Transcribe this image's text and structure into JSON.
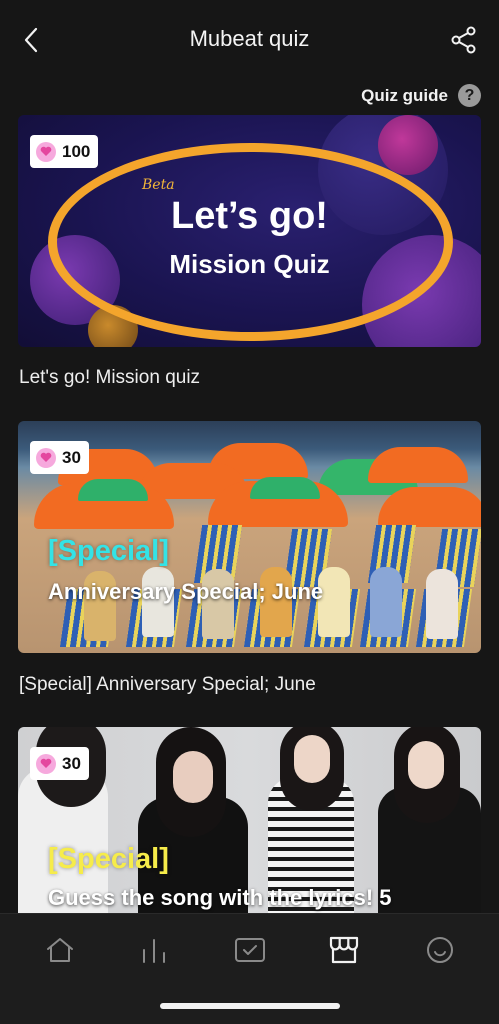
{
  "header": {
    "title": "Mubeat quiz",
    "back_icon": "chevron-left-icon",
    "share_icon": "share-icon"
  },
  "guide": {
    "label": "Quiz guide",
    "help_glyph": "?"
  },
  "cards": [
    {
      "badge_value": "100",
      "banner_beta": "Beta",
      "banner_line1": "Let’s go!",
      "banner_line2": "Mission Quiz",
      "caption": "Let's go! Mission quiz"
    },
    {
      "badge_value": "30",
      "banner_tag": "[Special]",
      "banner_title": "Anniversary Special; June",
      "caption": "[Special] Anniversary Special; June"
    },
    {
      "badge_value": "30",
      "banner_tag": "[Special]",
      "banner_title": "Guess the song with the lyrics! 5"
    }
  ],
  "tabs": [
    {
      "icon": "home-icon",
      "active": false
    },
    {
      "icon": "chart-icon",
      "active": false
    },
    {
      "icon": "quiz-check-icon",
      "active": false
    },
    {
      "icon": "store-icon",
      "active": true
    },
    {
      "icon": "smile-icon",
      "active": false
    }
  ],
  "colors": {
    "background": "#161616",
    "accent_orange": "#f4a52c",
    "special_cyan": "#34e3e6",
    "special_yellow": "#f6ec4a",
    "heart_pink": "#f6a9dd"
  }
}
